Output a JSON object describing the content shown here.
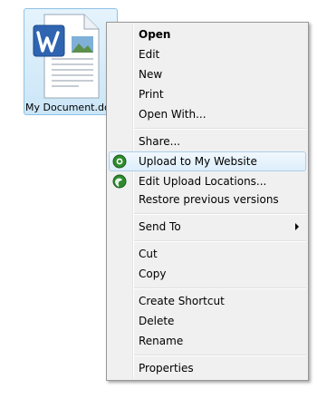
{
  "file": {
    "name": "My Document.docx",
    "icon": "word-document-icon"
  },
  "menu": {
    "open": "Open",
    "edit": "Edit",
    "new": "New",
    "print": "Print",
    "open_with": "Open With...",
    "share": "Share...",
    "upload": "Upload to My Website",
    "edit_upload": "Edit Upload Locations...",
    "restore": "Restore previous versions",
    "send_to": "Send To",
    "cut": "Cut",
    "copy": "Copy",
    "create_shortcut": "Create Shortcut",
    "delete": "Delete",
    "rename": "Rename",
    "properties": "Properties"
  },
  "colors": {
    "menu_background": "#f0f0f0",
    "highlight_border": "#aecfec",
    "selection_border": "#8fc3e6",
    "upload_icon": "#2e8b2e"
  }
}
